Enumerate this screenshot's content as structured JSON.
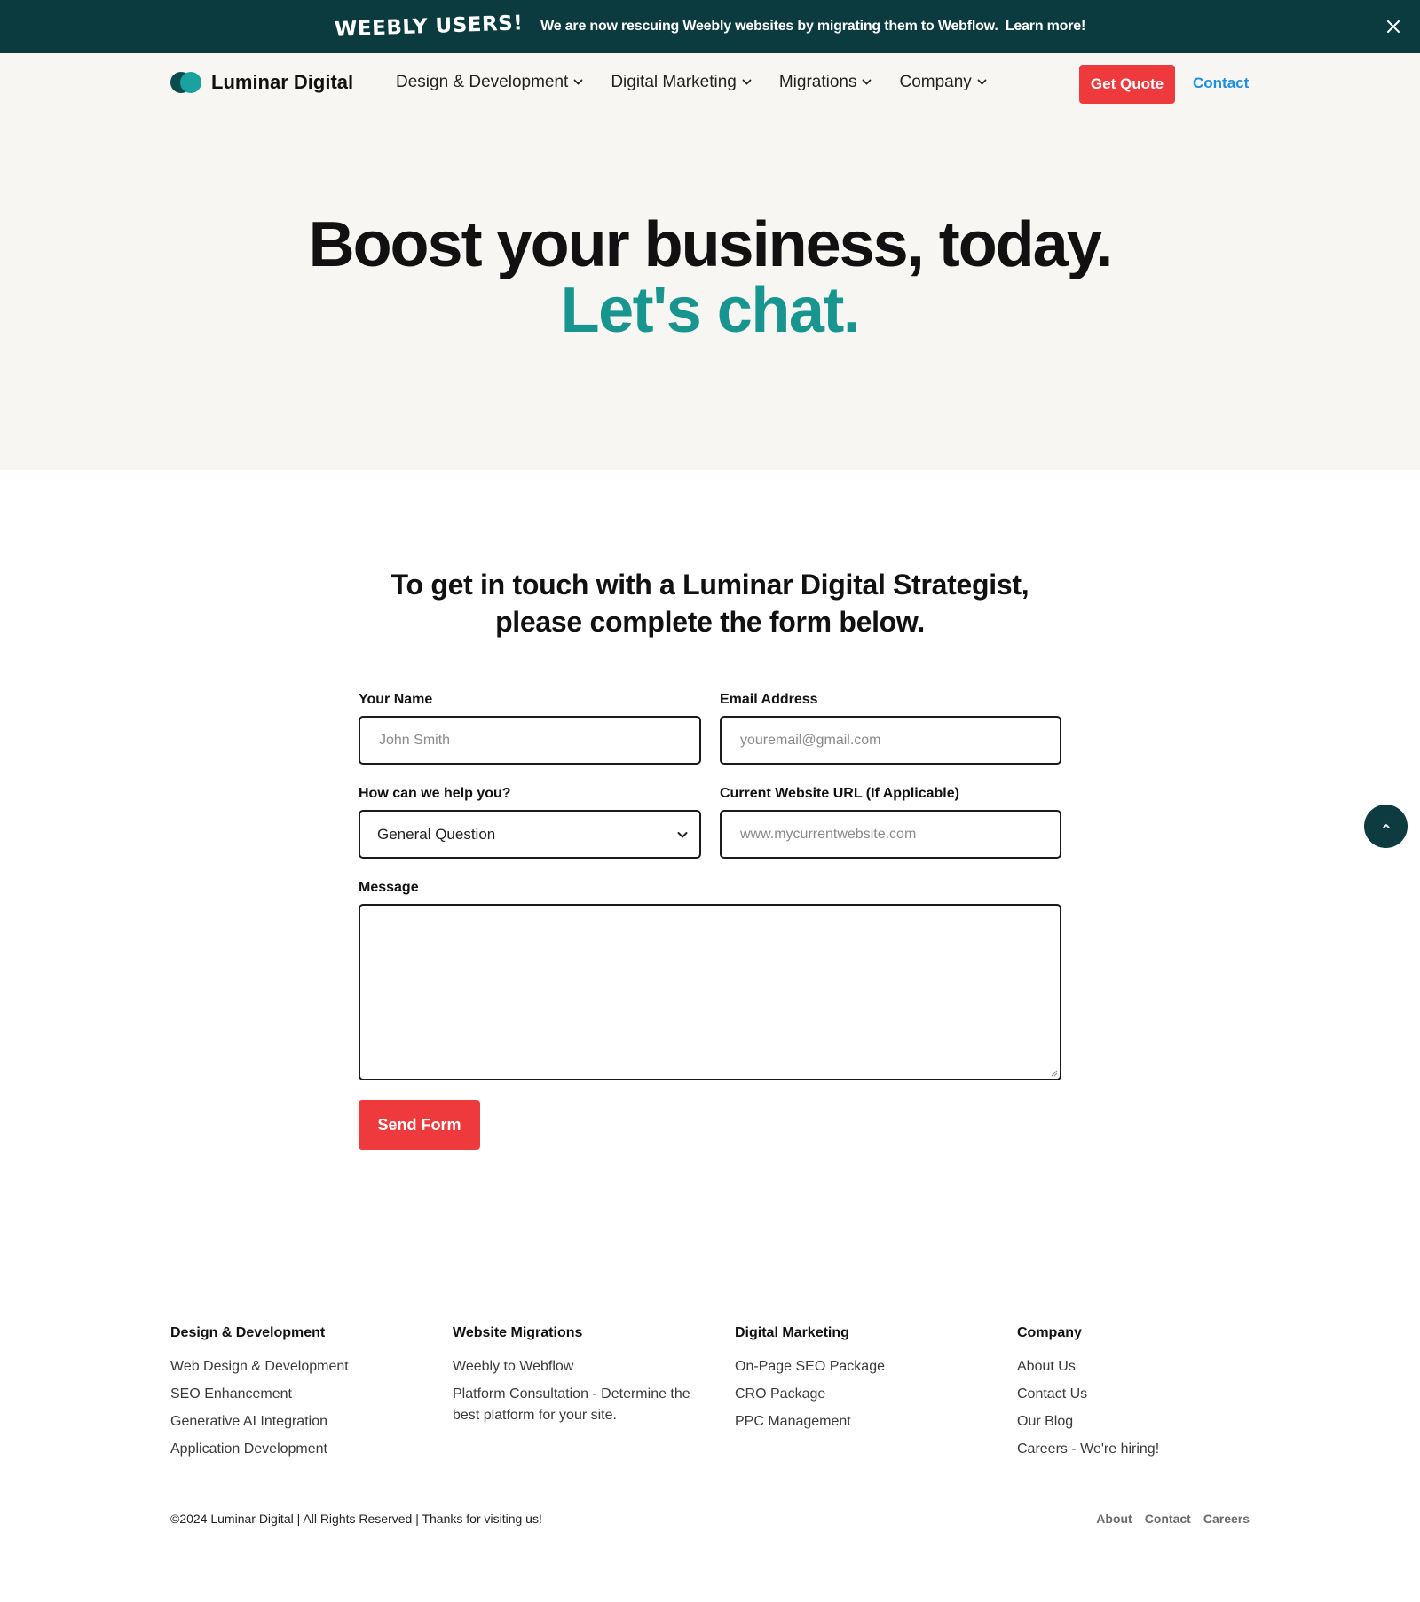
{
  "announcement": {
    "badge": "WEEBLY USERS!",
    "text": "We are now rescuing Weebly websites by migrating them to Webflow.",
    "link": "Learn more!"
  },
  "header": {
    "logo_text": "Luminar Digital",
    "nav": [
      {
        "label": "Design & Development"
      },
      {
        "label": "Digital Marketing"
      },
      {
        "label": "Migrations"
      },
      {
        "label": "Company"
      }
    ],
    "quote_button": "Get Quote",
    "contact_link": "Contact"
  },
  "hero": {
    "title": "Boost your business, today.",
    "subtitle": "Let's chat."
  },
  "form": {
    "heading_line1": "To get in touch with a Luminar Digital Strategist,",
    "heading_line2": "please complete the form below.",
    "name_label": "Your Name",
    "name_placeholder": "John Smith",
    "email_label": "Email Address",
    "email_placeholder": "youremail@gmail.com",
    "help_label": "How can we help you?",
    "help_value": "General Question",
    "url_label": "Current Website URL (If Applicable)",
    "url_placeholder": "www.mycurrentwebsite.com",
    "message_label": "Message",
    "send_button": "Send Form"
  },
  "footer": {
    "columns": [
      {
        "heading": "Design & Development",
        "links": [
          "Web Design & Development",
          "SEO Enhancement",
          "Generative AI Integration",
          "Application Development"
        ]
      },
      {
        "heading": "Website Migrations",
        "links": [
          "Weebly to Webflow",
          "Platform Consultation - Determine the best platform for your site."
        ]
      },
      {
        "heading": "Digital Marketing",
        "links": [
          "On-Page SEO Package",
          "CRO Package",
          "PPC Management"
        ]
      },
      {
        "heading": "Company",
        "links": [
          "About Us",
          "Contact Us",
          "Our Blog",
          "Careers - We're hiring!"
        ]
      }
    ],
    "copyright": "©2024 Luminar Digital | All Rights Reserved | Thanks for visiting us!",
    "bottom_links": [
      "About",
      "Contact",
      "Careers"
    ]
  },
  "colors": {
    "announcement_bg": "#0c3b3f",
    "accent_red": "#ee3a3d",
    "accent_teal": "#18958f",
    "link_blue": "#1d8ee0",
    "hero_bg": "#f7f6f3"
  },
  "icons": {
    "close": "close-icon",
    "chevron": "chevron-down-icon",
    "scroll_top": "chevron-up-icon",
    "resize": "resize-handle-icon"
  }
}
